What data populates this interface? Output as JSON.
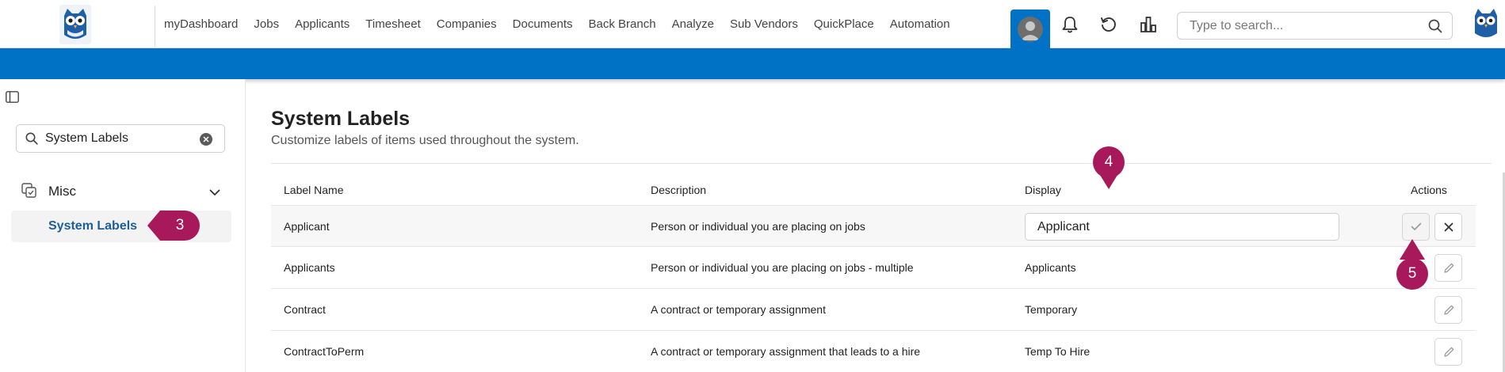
{
  "nav": {
    "items": [
      "myDashboard",
      "Jobs",
      "Applicants",
      "Timesheet",
      "Companies",
      "Documents",
      "Back Branch",
      "Analyze",
      "Sub Vendors",
      "QuickPlace",
      "Automation"
    ],
    "search_placeholder": "Type to search..."
  },
  "colors": {
    "brand_blue": "#0072c6",
    "marker": "#a8195c",
    "active_link": "#1b5e9b"
  },
  "sidebar": {
    "search_value": "System Labels",
    "group_label": "Misc",
    "active_item": "System Labels"
  },
  "page": {
    "title": "System Labels",
    "subtitle": "Customize labels of items used throughout the system."
  },
  "table": {
    "headers": {
      "name": "Label Name",
      "description": "Description",
      "display": "Display",
      "actions": "Actions"
    },
    "rows": [
      {
        "name": "Applicant",
        "description": "Person or individual you are placing on jobs",
        "display": "Applicant"
      },
      {
        "name": "Applicants",
        "description": "Person or individual you are placing on jobs - multiple",
        "display": "Applicants"
      },
      {
        "name": "Contract",
        "description": "A contract or temporary assignment",
        "display": "Temporary"
      },
      {
        "name": "ContractToPerm",
        "description": "A contract or temporary assignment that leads to a hire",
        "display": "Temp To Hire"
      }
    ]
  },
  "markers": {
    "m3": "3",
    "m4": "4",
    "m5": "5"
  }
}
